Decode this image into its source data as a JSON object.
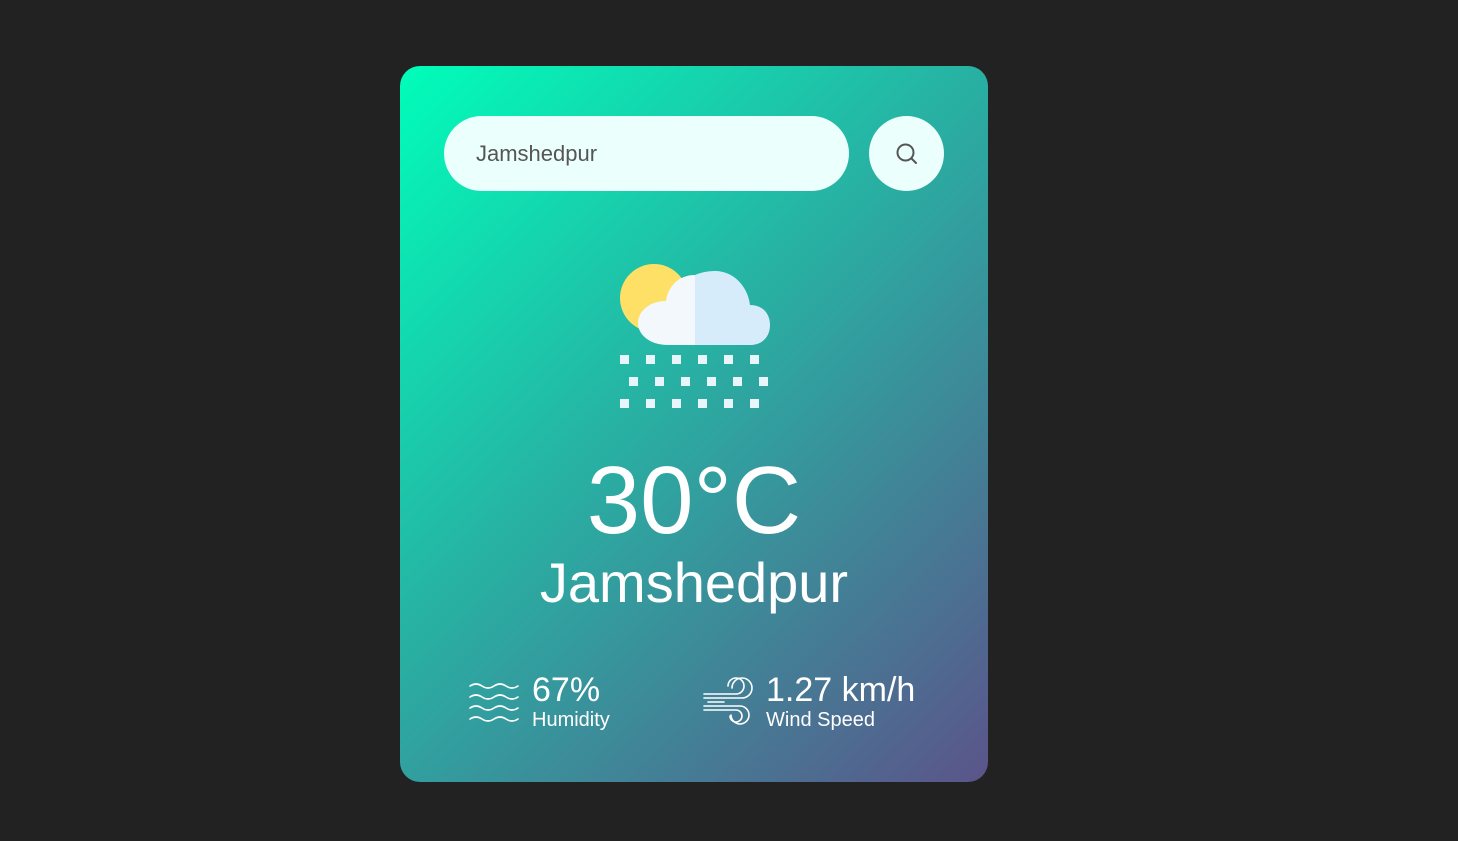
{
  "search": {
    "value": "Jamshedpur",
    "icon": "search-icon"
  },
  "weather": {
    "icon": "snow-cloud-sun-icon",
    "temperature": "30°C",
    "city": "Jamshedpur"
  },
  "details": {
    "humidity": {
      "icon": "humidity-waves-icon",
      "value": "67%",
      "label": "Humidity"
    },
    "wind": {
      "icon": "wind-icon",
      "value": "1.27 km/h",
      "label": "Wind Speed"
    }
  },
  "colors": {
    "page_background": "#222222",
    "gradient_start": "#00feba",
    "gradient_end": "#5b548a",
    "input_background": "#ebfffc"
  }
}
